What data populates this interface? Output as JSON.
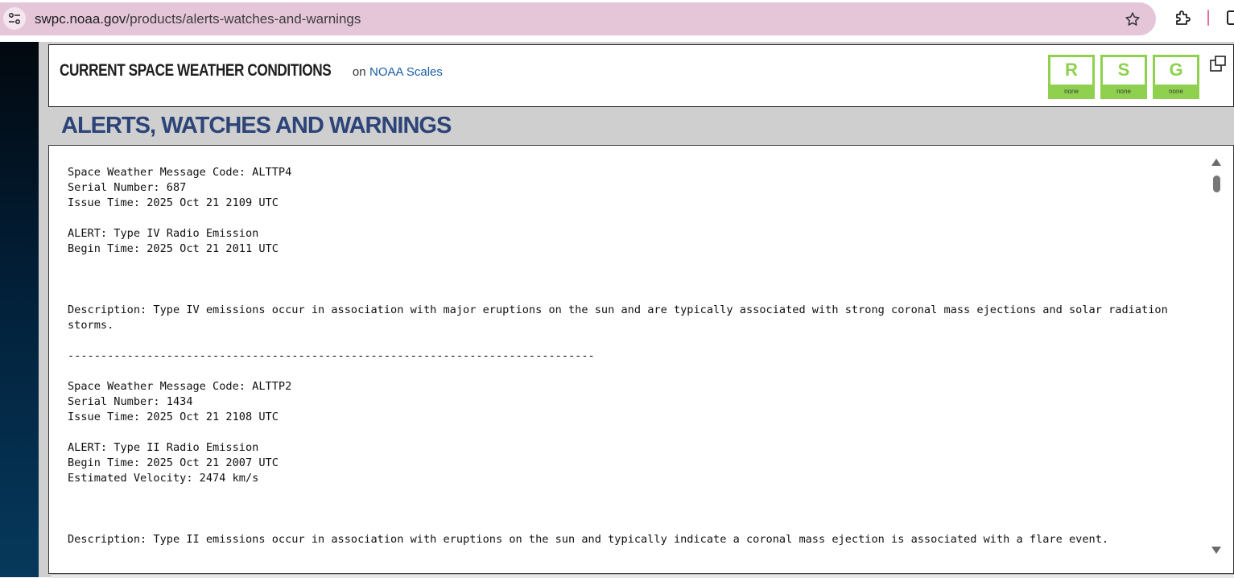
{
  "browser": {
    "url_host": "swpc.noaa.gov",
    "url_path": "/products/alerts-watches-and-warnings"
  },
  "conditions": {
    "title": "CURRENT SPACE WEATHER CONDITIONS",
    "on_text": "on",
    "scales_link": "NOAA Scales",
    "scales": [
      {
        "letter": "R",
        "status": "none"
      },
      {
        "letter": "S",
        "status": "none"
      },
      {
        "letter": "G",
        "status": "none"
      }
    ],
    "scale_color": "#8fd14f"
  },
  "page": {
    "heading": "ALERTS, WATCHES AND WARNINGS",
    "heading_color": "#2c4478"
  },
  "messages": {
    "text": "Space Weather Message Code: ALTTP4\nSerial Number: 687\nIssue Time: 2025 Oct 21 2109 UTC\n\nALERT: Type IV Radio Emission\nBegin Time: 2025 Oct 21 2011 UTC\n\n\n\nDescription: Type IV emissions occur in association with major eruptions on the sun and are typically associated with strong coronal mass ejections and solar radiation storms.\n\n--------------------------------------------------------------------------------\n\nSpace Weather Message Code: ALTTP2\nSerial Number: 1434\nIssue Time: 2025 Oct 21 2108 UTC\n\nALERT: Type II Radio Emission\nBegin Time: 2025 Oct 21 2007 UTC\nEstimated Velocity: 2474 km/s\n\n\n\nDescription: Type II emissions occur in association with eruptions on the sun and typically indicate a coronal mass ejection is associated with a flare event."
  }
}
